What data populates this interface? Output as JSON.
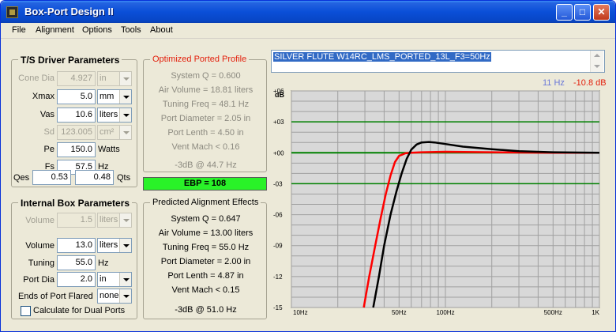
{
  "window": {
    "title": "Box-Port Design II",
    "minimize": "_",
    "maximize": "□",
    "close": "✕"
  },
  "menu": [
    "File",
    "Alignment",
    "Options",
    "Tools",
    "About"
  ],
  "ts_params": {
    "title": "T/S Driver Parameters",
    "cone_dia": {
      "label": "Cone Dia",
      "value": "4.927",
      "unit": "in"
    },
    "xmax": {
      "label": "Xmax",
      "value": "5.0",
      "unit": "mm"
    },
    "vas": {
      "label": "Vas",
      "value": "10.6",
      "unit": "liters"
    },
    "sd": {
      "label": "Sd",
      "value": "123.005",
      "unit": "cm²"
    },
    "pe": {
      "label": "Pe",
      "value": "150.0",
      "unit": "Watts"
    },
    "fs": {
      "label": "Fs",
      "value": "57.5",
      "unit": "Hz"
    },
    "qes": {
      "label": "Qes",
      "value": "0.53"
    },
    "qts": {
      "label": "Qts",
      "value": "0.48"
    }
  },
  "box_params": {
    "title": "Internal Box Parameters",
    "volume_dis": {
      "label": "Volume",
      "value": "1.5",
      "unit": "liters"
    },
    "volume": {
      "label": "Volume",
      "value": "13.0",
      "unit": "liters"
    },
    "tuning": {
      "label": "Tuning",
      "value": "55.0",
      "unit": "Hz"
    },
    "port_dia": {
      "label": "Port Dia",
      "value": "2.0",
      "unit": "in"
    },
    "ends_flared": {
      "label": "Ends of Port Flared",
      "value": "none"
    },
    "dual_ports": {
      "label": "Calculate for Dual Ports"
    }
  },
  "optimized": {
    "title": "Optimized Ported Profile",
    "lines": [
      "System Q = 0.600",
      "Air Volume = 18.81 liters",
      "Tuning Freq = 48.1 Hz",
      "Port Diameter = 2.05 in",
      "Port Lenth = 4.50 in",
      "Vent Mach < 0.16"
    ],
    "f3": "-3dB @ 44.7 Hz"
  },
  "ebp": "EBP = 108",
  "predicted": {
    "title": "Predicted Alignment Effects",
    "lines": [
      "System Q = 0.647",
      "Air Volume = 13.00 liters",
      "Tuning Freq = 55.0 Hz",
      "Port Diameter = 2.00 in",
      "Port Lenth = 4.87 in",
      "Vent Mach < 0.15"
    ],
    "f3": "-3dB @ 51.0 Hz"
  },
  "design_name": "SILVER FLUTE W14RC_LMS_PORTED_13L_F3=50Hz",
  "cursor": {
    "freq": "11 Hz",
    "db": "-10.8 dB"
  },
  "colors": {
    "optimized_curve": "#ff0000",
    "predicted_curve": "#000000",
    "grid": "#a0a0a0",
    "ref_lines": "#008000",
    "ebp": "#29f228"
  },
  "chart_data": {
    "type": "line",
    "title": "",
    "ylabel": "dB",
    "xscale": "log",
    "xlim": [
      10,
      1000
    ],
    "ylim": [
      -15,
      6
    ],
    "grid": true,
    "y_ticks": [
      "+06",
      "+03",
      "+00",
      "-03",
      "-06",
      "-09",
      "-12",
      "-15"
    ],
    "x_ticks": [
      {
        "value": 10,
        "label": "10Hz"
      },
      {
        "value": 50,
        "label": "50Hz"
      },
      {
        "value": 100,
        "label": "100Hz"
      },
      {
        "value": 500,
        "label": "500Hz"
      },
      {
        "value": 1000,
        "label": "1K"
      }
    ],
    "ref_lines": [
      3,
      0,
      -3
    ],
    "series": [
      {
        "color": "#ff0000",
        "x": [
          29.5,
          32,
          35,
          38,
          41,
          44,
          47,
          50,
          55,
          60,
          70,
          100,
          200,
          500,
          1000
        ],
        "y": [
          -15,
          -12,
          -9,
          -6.3,
          -4,
          -2.2,
          -0.9,
          -0.3,
          -0.05,
          0.0,
          0.05,
          0.1,
          0.05,
          0.0,
          0.0
        ]
      },
      {
        "color": "#000000",
        "x": [
          34,
          37,
          40,
          44,
          48,
          52,
          56,
          60,
          65,
          70,
          78,
          85,
          100,
          130,
          200,
          300,
          500,
          1000
        ],
        "y": [
          -15,
          -12,
          -9,
          -6,
          -3.8,
          -2.0,
          -0.6,
          0.3,
          0.8,
          1.0,
          1.05,
          1.0,
          0.85,
          0.6,
          0.35,
          0.15,
          0.05,
          0.0
        ]
      }
    ]
  }
}
